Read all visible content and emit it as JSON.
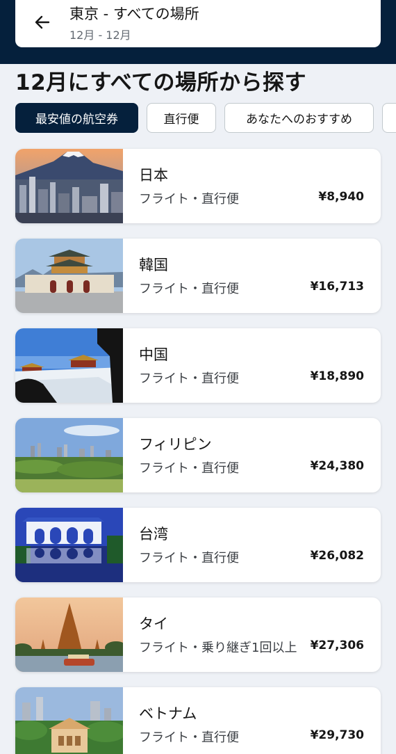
{
  "header": {
    "title": "東京 - すべての場所",
    "dates": "12月 - 12月"
  },
  "page_heading": "12月にすべての場所から探す",
  "filters": [
    {
      "label": "最安値の航空券",
      "selected": true
    },
    {
      "label": "直行便",
      "selected": false
    },
    {
      "label": "あなたへのおすすめ",
      "selected": false
    },
    {
      "label": "",
      "selected": false
    }
  ],
  "destinations": [
    {
      "name": "日本",
      "info": "フライト・直行便",
      "price": "¥8,940",
      "image": "mount-fuji-tokyo-skyline"
    },
    {
      "name": "韓国",
      "info": "フライト・直行便",
      "price": "¥16,713",
      "image": "gyeongbokgung-gate"
    },
    {
      "name": "中国",
      "info": "フライト・直行便",
      "price": "¥18,890",
      "image": "forbidden-city-snow"
    },
    {
      "name": "フィリピン",
      "info": "フライト・直行便",
      "price": "¥24,380",
      "image": "manila-skyline-greenery"
    },
    {
      "name": "台湾",
      "info": "フライト・直行便",
      "price": "¥26,082",
      "image": "liberty-square-gate-night"
    },
    {
      "name": "タイ",
      "info": "フライト・乗り継ぎ1回以上",
      "price": "¥27,306",
      "image": "wat-arun-temple"
    },
    {
      "name": "ベトナム",
      "info": "フライト・直行便",
      "price": "¥29,730",
      "image": "saigon-opera-house"
    }
  ],
  "colors": {
    "header_bg": "#05203c",
    "page_bg": "#eef1f6",
    "chip_active_bg": "#05203c"
  }
}
